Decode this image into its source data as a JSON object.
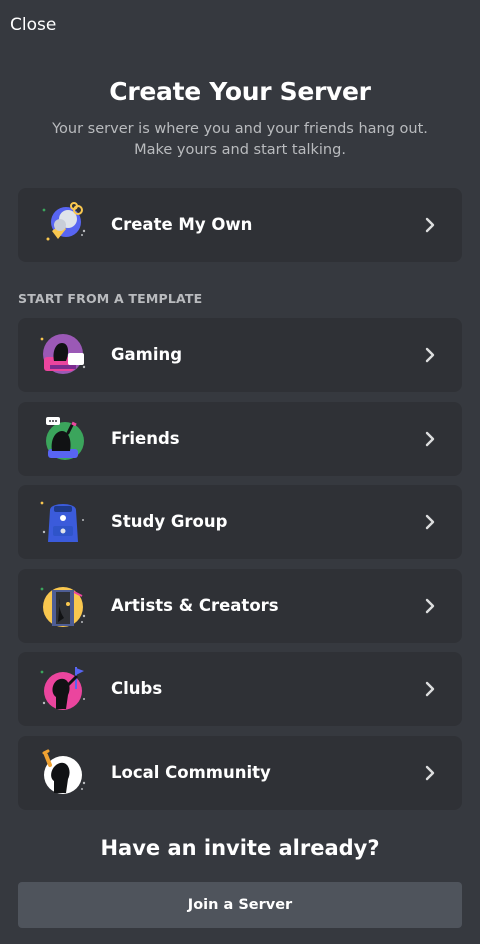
{
  "header": {
    "close_label": "Close"
  },
  "main": {
    "title": "Create Your Server",
    "subtitle_line1": "Your server is where you and your friends hang out.",
    "subtitle_line2": "Make yours and start talking."
  },
  "create_own": {
    "label": "Create My Own",
    "icon": "create-my-own-icon"
  },
  "templates": {
    "header": "START FROM A TEMPLATE",
    "items": [
      {
        "label": "Gaming",
        "icon": "gaming-icon"
      },
      {
        "label": "Friends",
        "icon": "friends-icon"
      },
      {
        "label": "Study Group",
        "icon": "study-group-icon"
      },
      {
        "label": "Artists & Creators",
        "icon": "artists-creators-icon"
      },
      {
        "label": "Clubs",
        "icon": "clubs-icon"
      },
      {
        "label": "Local Community",
        "icon": "local-community-icon"
      }
    ]
  },
  "invite": {
    "heading": "Have an invite already?",
    "button_label": "Join a Server"
  },
  "colors": {
    "background": "#36393f",
    "card": "#2f3136",
    "button": "#4f545c",
    "muted_text": "#b9bbbe"
  }
}
